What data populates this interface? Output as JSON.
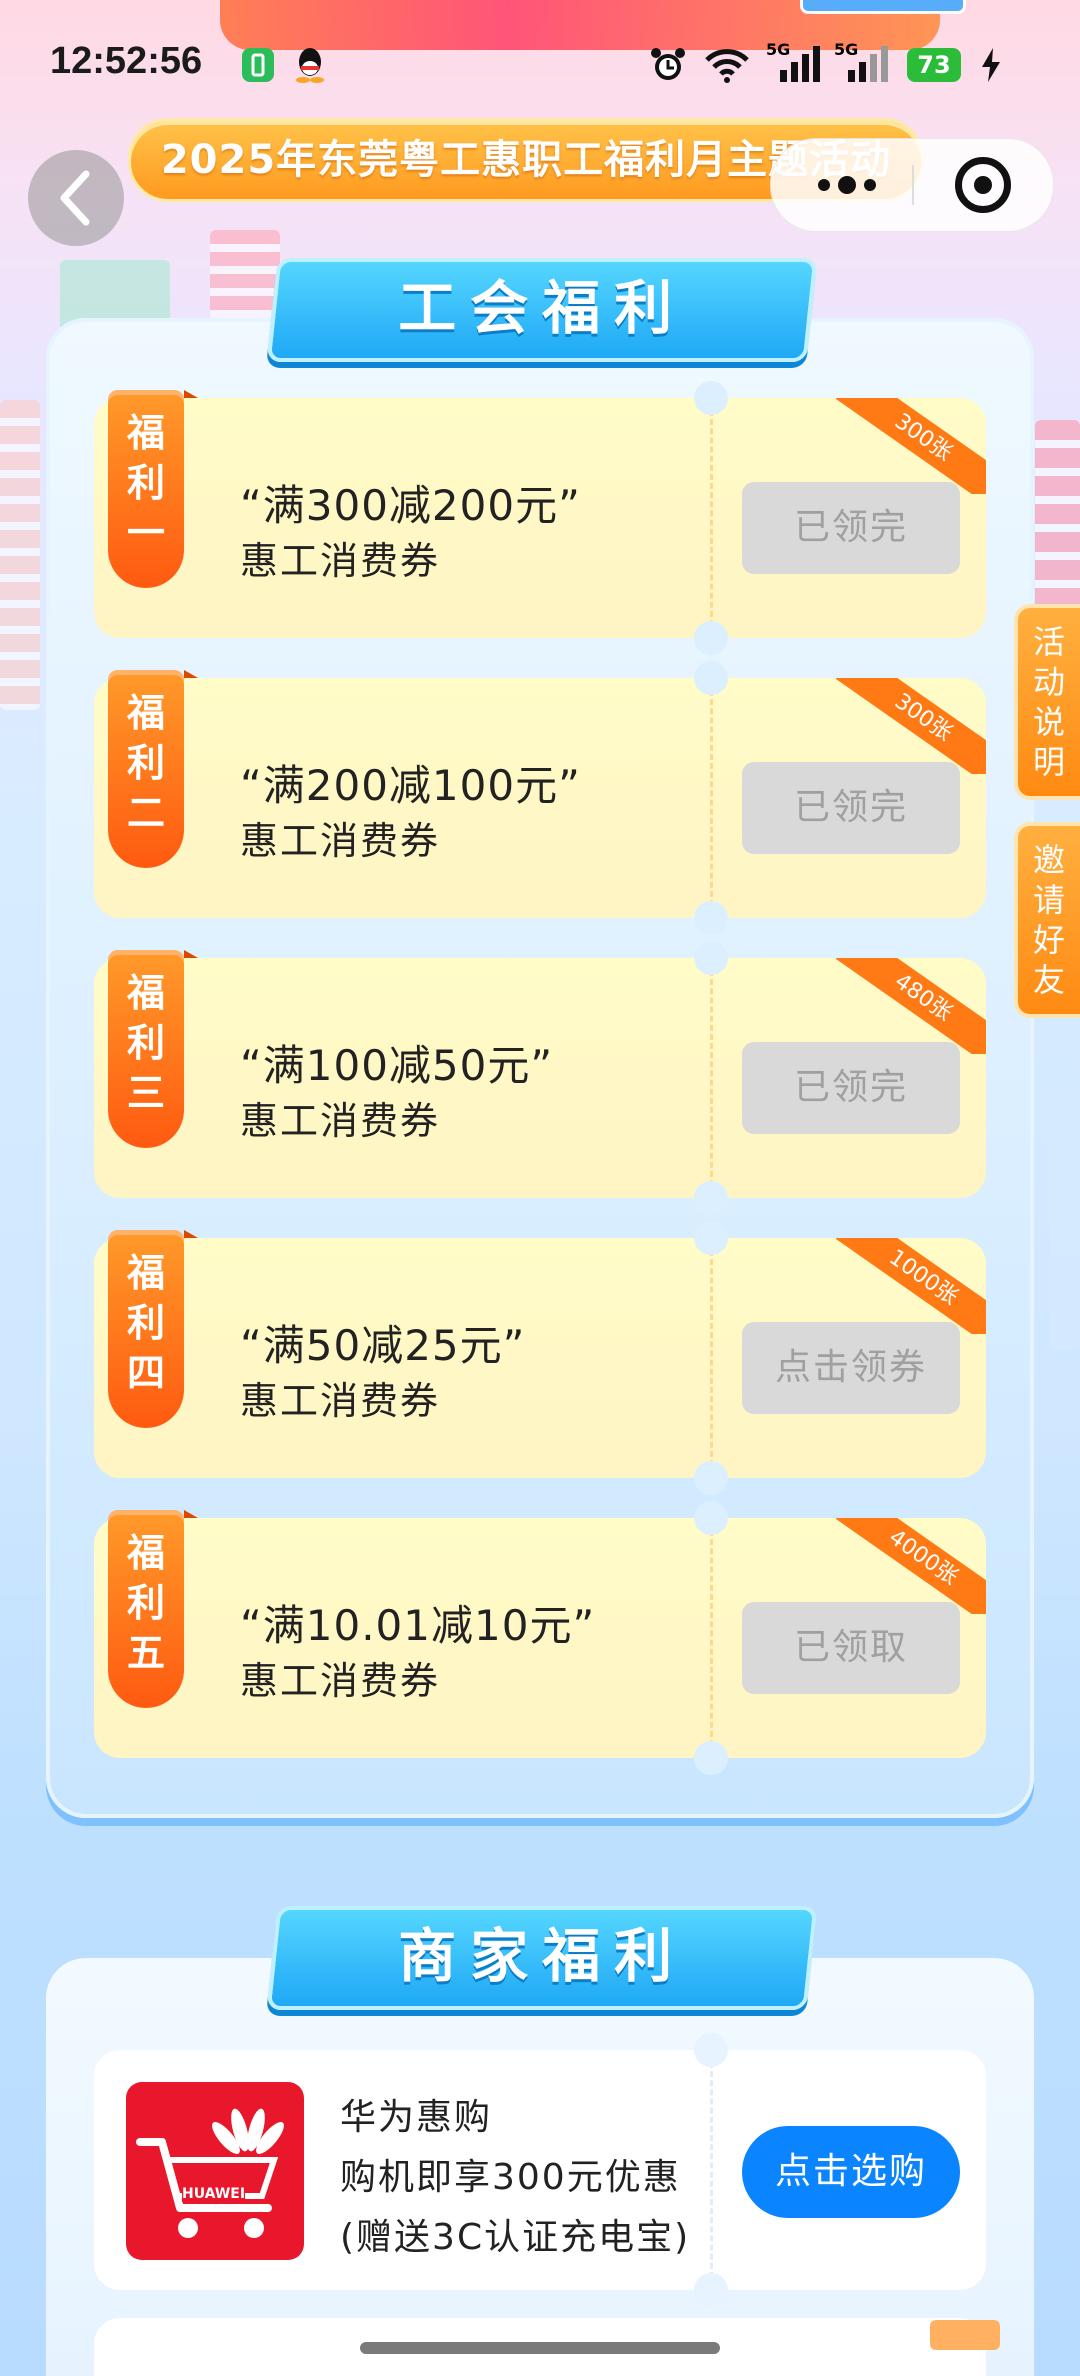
{
  "status_bar": {
    "time": "12:52:56",
    "battery": "73",
    "net1": "5G",
    "net2": "5G"
  },
  "banner": {
    "tag": "惠工消费券",
    "title": "2025年东莞粤工惠职工福利月主题活动"
  },
  "union_section": {
    "title": "工会福利",
    "coupons": [
      {
        "ribbon": [
          "福",
          "利",
          "一"
        ],
        "title": "“满300减200元”",
        "subtitle": "惠工消费券",
        "badge": "300张",
        "button": "已领完"
      },
      {
        "ribbon": [
          "福",
          "利",
          "二"
        ],
        "title": "“满200减100元”",
        "subtitle": "惠工消费券",
        "badge": "300张",
        "button": "已领完"
      },
      {
        "ribbon": [
          "福",
          "利",
          "三"
        ],
        "title": "“满100减50元”",
        "subtitle": "惠工消费券",
        "badge": "480张",
        "button": "已领完"
      },
      {
        "ribbon": [
          "福",
          "利",
          "四"
        ],
        "title": "“满50减25元”",
        "subtitle": "惠工消费券",
        "badge": "1000张",
        "button": "点击领券"
      },
      {
        "ribbon": [
          "福",
          "利",
          "五"
        ],
        "title": "“满10.01减10元”",
        "subtitle": "惠工消费券",
        "badge": "4000张",
        "button": "已领取"
      }
    ]
  },
  "side_tabs": [
    {
      "chars": [
        "活",
        "动",
        "说",
        "明"
      ]
    },
    {
      "chars": [
        "邀",
        "请",
        "好",
        "友"
      ]
    }
  ],
  "merchant_section": {
    "title": "商家福利",
    "item": {
      "name": "华为惠购",
      "line1": "购机即享300元优惠",
      "line2": "(赠送3C认证充电宝)",
      "button": "点击选购",
      "logo_text": "HUAWEI"
    }
  },
  "colors": {
    "accent_orange": "#ff7a14",
    "primary_blue": "#0a84ff",
    "disabled_gray": "#d9d9d9"
  }
}
